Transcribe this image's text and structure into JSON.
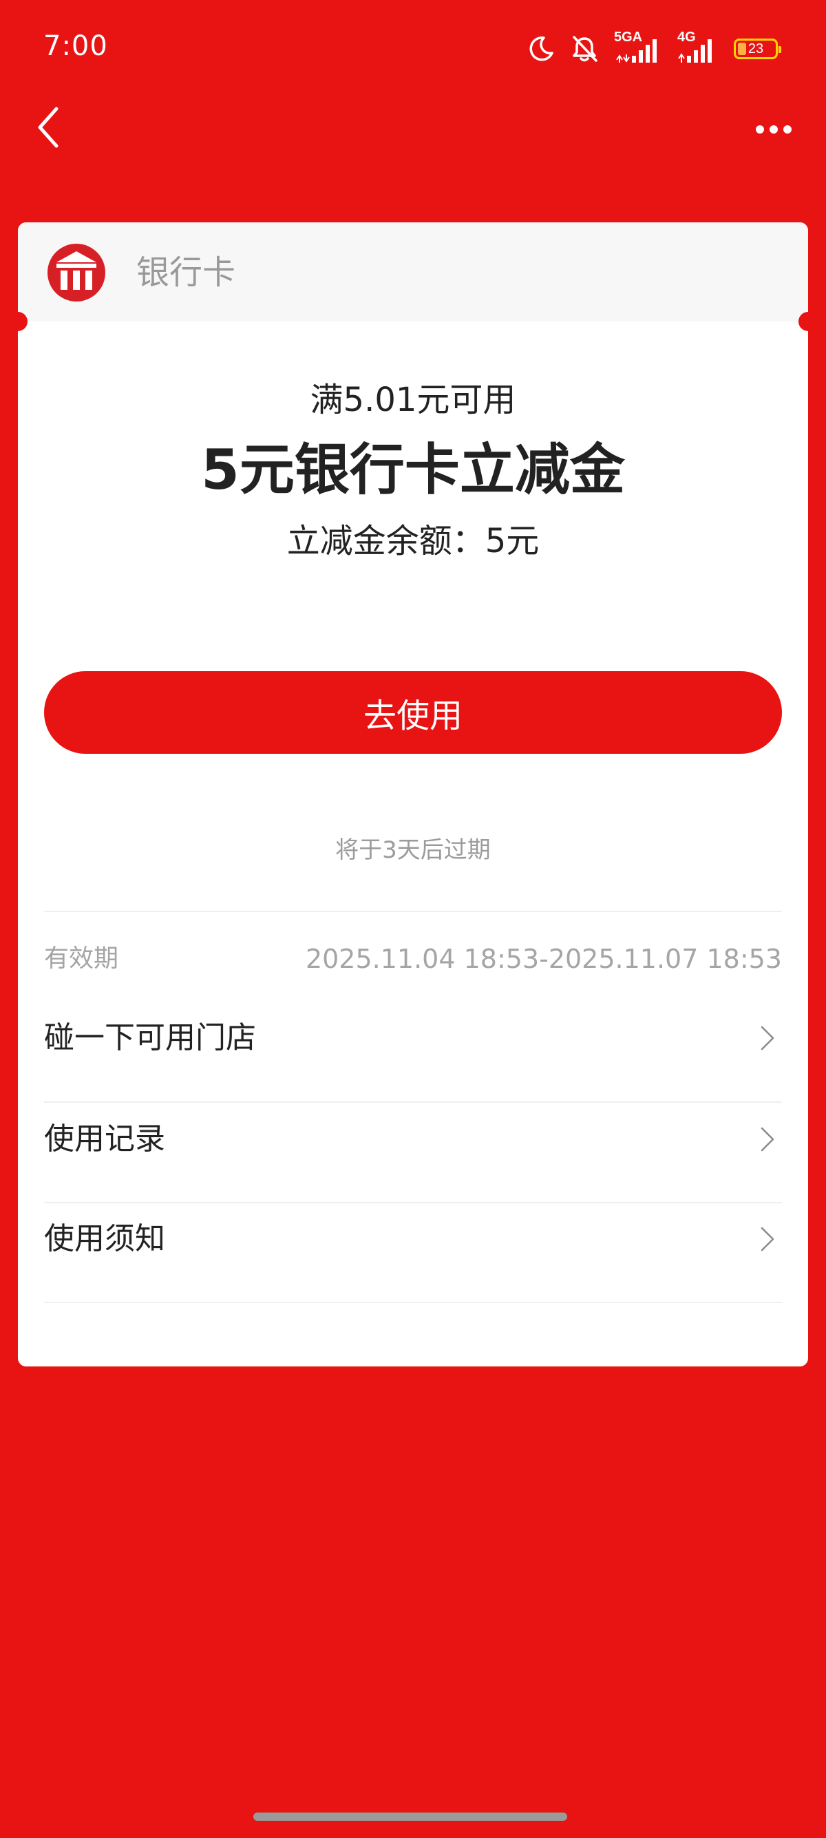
{
  "status_bar": {
    "time": "7:00",
    "signal1_label": "5GA",
    "signal2_label": "4G",
    "battery_level": 23,
    "battery_text": "23"
  },
  "card": {
    "header_title": "银行卡",
    "condition": "满5.01元可用",
    "coupon_title": "5元银行卡立减金",
    "balance": "立减金余额：5元",
    "use_button": "去使用",
    "expiry_note": "将于3天后过期",
    "validity_label": "有效期",
    "validity_value": "2025.11.04 18:53-2025.11.07 18:53",
    "rows": [
      {
        "label": "碰一下可用门店"
      },
      {
        "label": "使用记录"
      },
      {
        "label": "使用须知"
      }
    ]
  },
  "colors": {
    "brand_red": "#E81413",
    "text_dark": "#222222",
    "text_muted": "#A5A5A5"
  },
  "icons": {
    "back": "chevron-left-icon",
    "more": "more-dots-icon",
    "bank": "bank-icon",
    "row_arrow": "chevron-right-icon"
  }
}
